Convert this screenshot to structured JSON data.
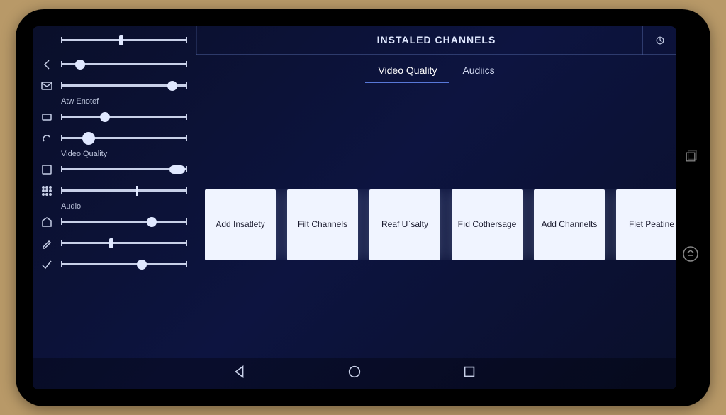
{
  "header": {
    "title": "INSTALED CHANNELS"
  },
  "tabs": [
    {
      "label": "Video Quality",
      "active": true
    },
    {
      "label": "Audiics",
      "active": false
    }
  ],
  "sidebar": {
    "topSlider": {
      "value": 48
    },
    "rows": [
      {
        "icon": "chevron-left",
        "value": 15,
        "thumb": "normal"
      },
      {
        "icon": "mail",
        "value": 88,
        "thumb": "normal",
        "label": "Atw Enotef"
      },
      {
        "icon": "rect",
        "value": 35,
        "thumb": "normal"
      },
      {
        "icon": "loop",
        "value": 22,
        "thumb": "big"
      },
      {
        "icon": "crop",
        "value": 92,
        "thumb": "capsule",
        "label": "Video Quality"
      },
      {
        "icon": "grid",
        "value": 60,
        "thumb": "line"
      },
      {
        "icon": "tag",
        "value": 72,
        "thumb": "normal",
        "label": "Audio"
      },
      {
        "icon": "pen",
        "value": 40,
        "thumb": "rect"
      },
      {
        "icon": "check",
        "value": 64,
        "thumb": "normal"
      }
    ]
  },
  "cards": [
    "Add Insatlety",
    "Filt Channels",
    "Reaf Uˈsalty",
    "Fıd Cothersage",
    "Add Channelts",
    "Flet Peatine"
  ]
}
